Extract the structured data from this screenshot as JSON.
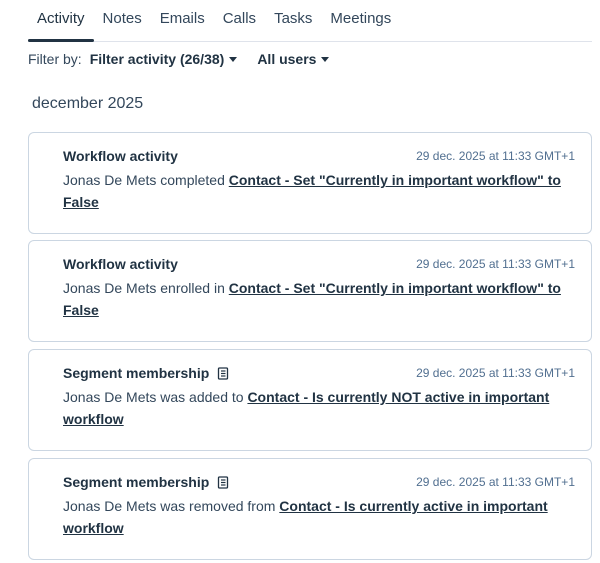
{
  "tabs": [
    {
      "label": "Activity",
      "active": true
    },
    {
      "label": "Notes"
    },
    {
      "label": "Emails"
    },
    {
      "label": "Calls"
    },
    {
      "label": "Tasks"
    },
    {
      "label": "Meetings"
    }
  ],
  "filter": {
    "label": "Filter by:",
    "activity": "Filter activity (26/38)",
    "users": "All users"
  },
  "month": "december 2025",
  "cards": [
    {
      "title": "Workflow activity",
      "time": "29 dec. 2025 at 11:33 GMT+1",
      "text": "Jonas De Mets completed ",
      "link": "Contact - Set \"Currently in important workflow\" to False",
      "icon": null
    },
    {
      "title": "Workflow activity",
      "time": "29 dec. 2025 at 11:33 GMT+1",
      "text": "Jonas De Mets enrolled in ",
      "link": "Contact - Set \"Currently in important workflow\" to False",
      "icon": null
    },
    {
      "title": "Segment membership",
      "time": "29 dec. 2025 at 11:33 GMT+1",
      "text": "Jonas De Mets was added to ",
      "link": "Contact - Is currently NOT active in important workflow",
      "icon": "segment-list-icon"
    },
    {
      "title": "Segment membership",
      "time": "29 dec. 2025 at 11:33 GMT+1",
      "text": "Jonas De Mets was removed from ",
      "link": "Contact - Is currently active in important workflow",
      "icon": "segment-list-icon"
    }
  ]
}
